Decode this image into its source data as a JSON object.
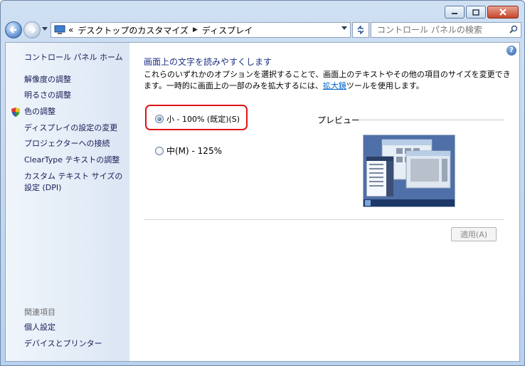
{
  "window": {
    "caption_buttons": [
      "minimize",
      "maximize",
      "close"
    ]
  },
  "address_bar": {
    "prefix": "«",
    "crumbs": [
      "デスクトップのカスタマイズ",
      "ディスプレイ"
    ],
    "search_placeholder": "コントロール パネルの検索"
  },
  "sidebar": {
    "home": "コントロール パネル ホーム",
    "items": [
      "解像度の調整",
      "明るさの調整",
      "色の調整",
      "ディスプレイの設定の変更",
      "プロジェクターへの接続",
      "ClearType テキストの調整",
      "カスタム テキスト サイズの設定 (DPI)"
    ],
    "related_heading": "関連項目",
    "related": [
      "個人設定",
      "デバイスとプリンター"
    ]
  },
  "main": {
    "title": "画面上の文字を読みやすくします",
    "desc_before_link": "これらのいずれかのオプションを選択することで、画面上のテキストやその他の項目のサイズを変更できます。一時的に画面上の一部のみを拡大するには、",
    "desc_link": "拡大鏡",
    "desc_after_link": "ツールを使用します。",
    "options": [
      {
        "label": "小 - 100% (既定)(S)",
        "checked": true
      },
      {
        "label": "中(M) - 125%",
        "checked": false
      }
    ],
    "preview_label": "プレビュー",
    "apply_label": "適用(A)",
    "help_glyph": "?"
  },
  "colors": {
    "highlight": "#e01414",
    "link": "#0066cc"
  }
}
